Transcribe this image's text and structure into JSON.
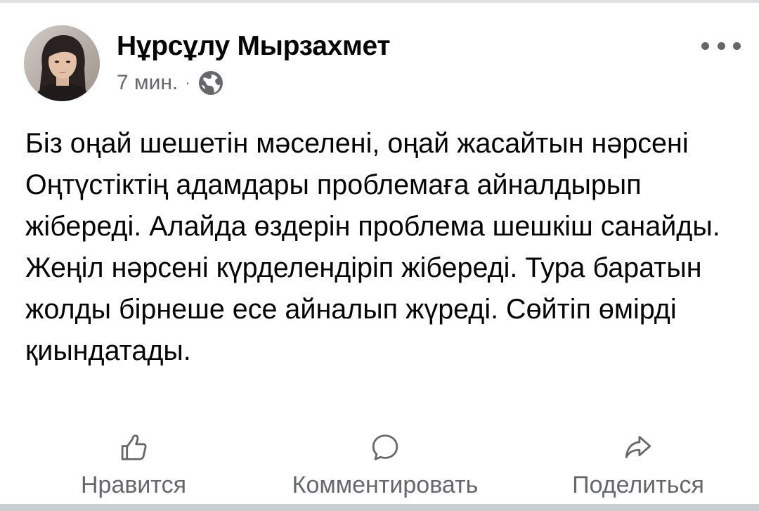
{
  "post": {
    "author": {
      "name": "Нұрсұлу Мырзахмет",
      "avatar_icon": "user-photo"
    },
    "meta": {
      "time": "7 мин.",
      "separator": "·",
      "privacy_icon": "globe-icon"
    },
    "menu_icon": "more-horizontal-icon",
    "text": "Біз оңай шешетін мәселені, оңай жасайтын нәрсені Оңтүстіктің адамдары проблемаға айналдырып жібереді. Алайда өздерін проблема шешкіш санайды. Жеңіл нәрсені күрделендіріп жібереді. Тура баратын жолды бірнеше есе айналып жүреді. Сөйтіп өмірді қиындатады."
  },
  "actions": {
    "like": {
      "label": "Нравится",
      "icon": "thumbs-up-icon"
    },
    "comment": {
      "label": "Комментировать",
      "icon": "comment-icon"
    },
    "share": {
      "label": "Поделиться",
      "icon": "share-icon"
    }
  },
  "colors": {
    "text_primary": "#050505",
    "text_secondary": "#65676b",
    "divider": "#dfe1e5"
  }
}
